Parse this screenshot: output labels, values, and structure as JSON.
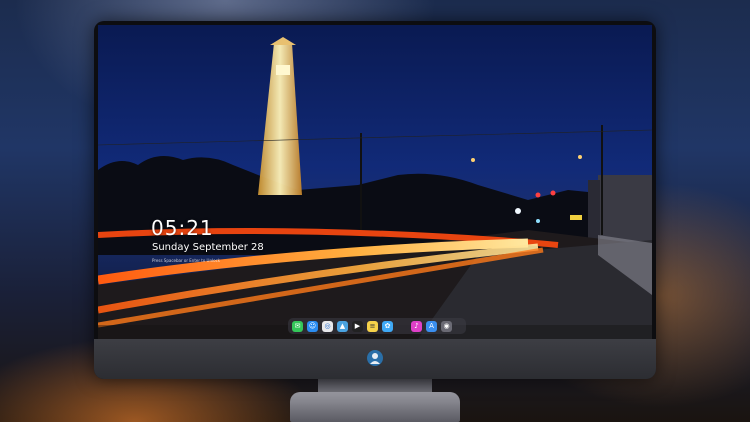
{
  "lock_screen": {
    "time": "05:21",
    "date": "Sunday September  28",
    "subtext": "Press Spacebar or Enter to Unlock"
  },
  "dock": {
    "apps": [
      {
        "name": "messages-icon",
        "color": "#34c759"
      },
      {
        "name": "finder-icon",
        "color": "#2a8cf0"
      },
      {
        "name": "safari-icon",
        "color": "#e8e8ea"
      },
      {
        "name": "maps-icon",
        "color": "#4aa3e0"
      },
      {
        "name": "video-icon",
        "color": "#222222"
      },
      {
        "name": "notes-icon",
        "color": "#f6d24a"
      },
      {
        "name": "photos-icon",
        "color": "#3fa9f5"
      },
      {
        "name": "music-icon",
        "color": "#e040c8"
      },
      {
        "name": "app-store-icon",
        "color": "#3a8ff0"
      },
      {
        "name": "camera-icon",
        "color": "#6a6a74"
      }
    ]
  },
  "colors": {
    "sky": "#112a78",
    "light_trail": "#ff7a1a",
    "tower_lights": "#ffe7a0"
  }
}
